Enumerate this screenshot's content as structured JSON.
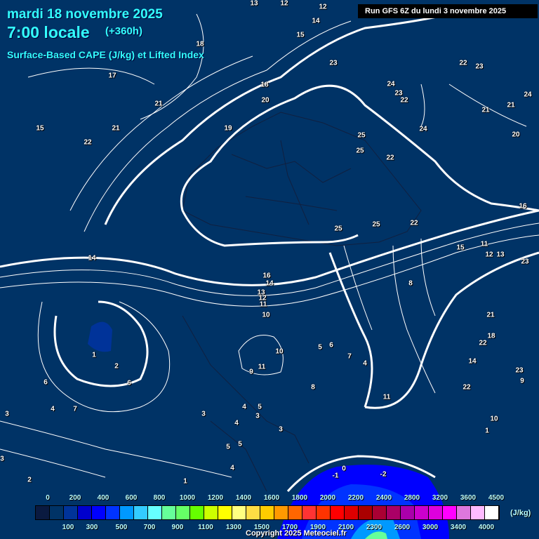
{
  "header": {
    "date": "mardi 18 novembre 2025",
    "time": "7:00 locale",
    "lead": "(+360h)",
    "parameter": "Surface-Based CAPE (J/kg) et Lifted Index",
    "run": "Run GFS 6Z du lundi 3 novembre 2025"
  },
  "legend": {
    "unit": "(J/kg)",
    "top_labels": [
      "0",
      "200",
      "400",
      "600",
      "800",
      "1000",
      "1200",
      "1400",
      "1600",
      "1800",
      "2000",
      "2200",
      "2400",
      "2800",
      "3200",
      "3600",
      "4500"
    ],
    "bottom_labels": [
      "100",
      "300",
      "500",
      "700",
      "900",
      "1100",
      "1300",
      "1500",
      "1700",
      "1900",
      "2100",
      "2300",
      "2600",
      "3000",
      "3400",
      "4000"
    ],
    "colors": [
      "#0a1a40",
      "#003366",
      "#003399",
      "#0000cc",
      "#0000ff",
      "#0033ff",
      "#0099ff",
      "#33ccff",
      "#66ffff",
      "#66ff99",
      "#66ff66",
      "#66ff00",
      "#ccff00",
      "#ffff00",
      "#ffff80",
      "#ffdd44",
      "#ffcc00",
      "#ff9900",
      "#ff6600",
      "#ff3333",
      "#ff3300",
      "#ff0000",
      "#dd0000",
      "#aa0000",
      "#aa0033",
      "#aa0066",
      "#aa00aa",
      "#cc00cc",
      "#dd00dd",
      "#ff00ff",
      "#dd77dd",
      "#ffbbff",
      "#ffffff"
    ]
  },
  "lifted_index_labels": [
    "13",
    "12",
    "12",
    "14",
    "15",
    "18",
    "17",
    "18",
    "20",
    "21",
    "21",
    "22",
    "15",
    "19",
    "23",
    "22",
    "23",
    "24",
    "23",
    "22",
    "24",
    "25",
    "25",
    "22",
    "21",
    "21",
    "20",
    "24",
    "25",
    "25",
    "22",
    "14",
    "16",
    "14",
    "13",
    "12",
    "11",
    "10",
    "8",
    "10",
    "11",
    "9",
    "8",
    "6",
    "5",
    "4",
    "7",
    "11",
    "15",
    "11",
    "12",
    "13",
    "16",
    "23",
    "21",
    "22",
    "18",
    "14",
    "22",
    "23",
    "9",
    "10",
    "1",
    "1",
    "2",
    "6",
    "6",
    "4",
    "7",
    "3",
    "3",
    "4",
    "5",
    "3",
    "4",
    "3",
    "5",
    "5",
    "4",
    "1",
    "2",
    "3",
    "-1",
    "-2",
    "0"
  ],
  "copyright": "Copyright 2025 Meteociel.fr"
}
